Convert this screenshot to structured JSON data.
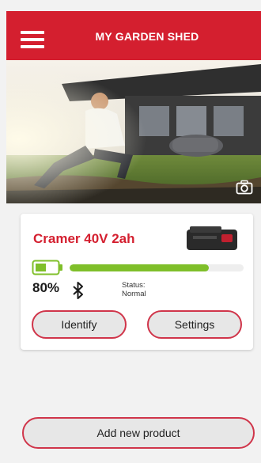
{
  "header": {
    "title": "MY GARDEN SHED",
    "menu_icon": "hamburger-menu-icon"
  },
  "hero": {
    "camera_icon": "camera-icon"
  },
  "device": {
    "name": "Cramer 40V 2ah",
    "battery_percent_label": "80%",
    "battery_level": 0.8,
    "status_label": "Status:",
    "status_value": "Normal",
    "bluetooth_icon": "bluetooth-icon",
    "identify_label": "Identify",
    "settings_label": "Settings"
  },
  "footer": {
    "add_product_label": "Add new product"
  },
  "colors": {
    "brand_red": "#d41f2f",
    "progress_green": "#7fbf2a",
    "button_border": "#d0354a"
  }
}
